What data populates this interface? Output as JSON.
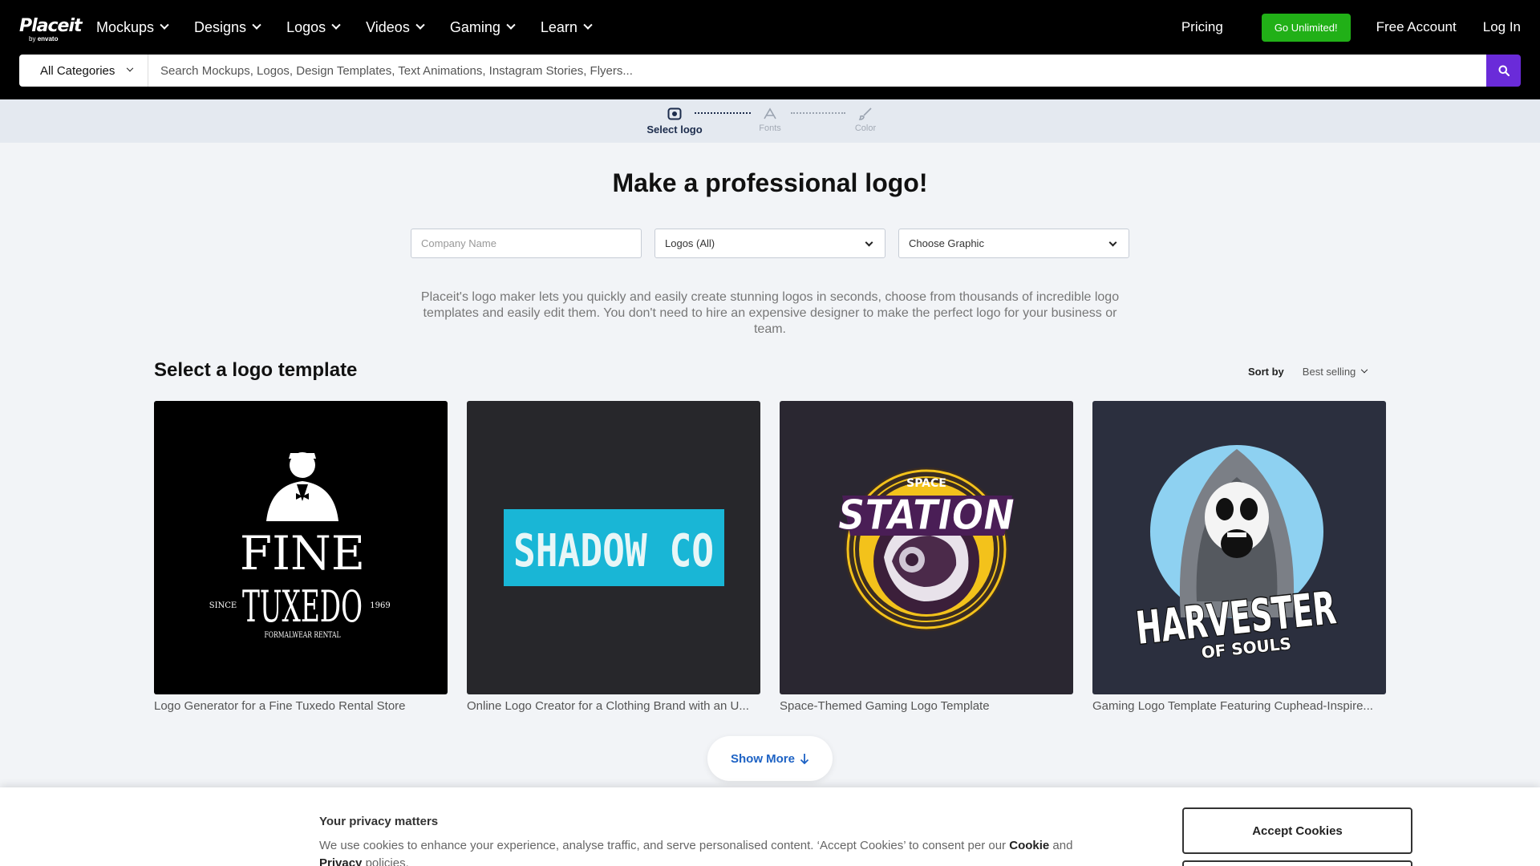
{
  "nav": {
    "logo_word": "Placeit",
    "logo_by": "by",
    "logo_brand": "envato",
    "menu": [
      {
        "label": "Mockups"
      },
      {
        "label": "Designs"
      },
      {
        "label": "Logos"
      },
      {
        "label": "Videos"
      },
      {
        "label": "Gaming"
      },
      {
        "label": "Learn"
      }
    ],
    "pricing": "Pricing",
    "unlimited": "Go Unlimited!",
    "free_account": "Free Account",
    "login": "Log In"
  },
  "search": {
    "category": "All Categories",
    "placeholder": "Search Mockups, Logos, Design Templates, Text Animations, Instagram Stories, Flyers..."
  },
  "stepper": {
    "steps": [
      {
        "label": "Select logo",
        "icon": "logo-select-icon",
        "active": true
      },
      {
        "label": "Fonts",
        "icon": "fonts-icon",
        "active": false
      },
      {
        "label": "Color",
        "icon": "paint-brush-icon",
        "active": false
      }
    ]
  },
  "main": {
    "headline": "Make a professional logo!",
    "company_placeholder": "Company Name",
    "logo_type": "Logos (All)",
    "graphic": "Choose Graphic",
    "description": "Placeit's logo maker lets you quickly and easily create stunning logos in seconds, choose from thousands of incredible logo templates and easily edit them. You don't need to hire an expensive designer to make the perfect logo for your business or team.",
    "section_title": "Select a logo template",
    "sort_label": "Sort by",
    "sort_value": "Best selling",
    "show_more": "Show More"
  },
  "cards": [
    {
      "caption": "Logo Generator for a Fine Tuxedo Rental Store",
      "art": {
        "line1": "FINE",
        "line2": "TUXEDO",
        "since": "SINCE",
        "year": "1969",
        "sub": "FORMALWEAR RENTAL"
      }
    },
    {
      "caption": "Online Logo Creator for a Clothing Brand with an U...",
      "art": {
        "text": "SHADOW CO"
      }
    },
    {
      "caption": "Space-Themed Gaming Logo Template",
      "art": {
        "top": "SPACE",
        "main": "STATION"
      }
    },
    {
      "caption": "Gaming Logo Template Featuring Cuphead-Inspire...",
      "art": {
        "main": "HARVESTER",
        "sub": "OF SOULS"
      }
    }
  ],
  "cookie": {
    "title": "Your privacy matters",
    "text_before": "We use cookies to enhance your experience, analyse traffic, and serve personalised content. ‘Accept Cookies’ to consent per our",
    "cookie_link": "Cookie",
    "and": "and",
    "privacy_link": "Privacy",
    "text_after": "policies.",
    "accept": "Accept Cookies"
  },
  "colors": {
    "nav_bg": "#000000",
    "accent_green": "#21b017",
    "accent_purple": "#6a2bd9",
    "link_blue": "#1d62c4"
  }
}
